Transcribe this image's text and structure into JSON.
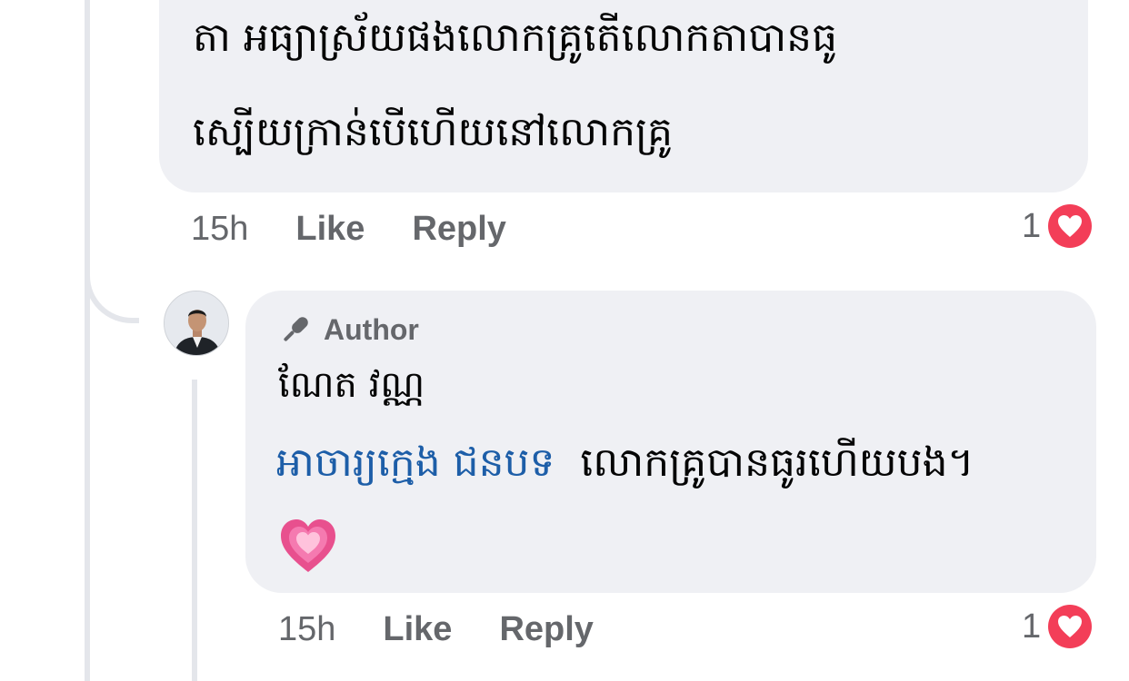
{
  "comment": {
    "lines": [
      "តា អធ្យាស្រ័យផងលោកគ្រូតើលោកតាបានធូ",
      "ស្បើយក្រាន់បើហើយនៅលោកគ្រូ"
    ],
    "time": "15h",
    "like_label": "Like",
    "reply_label": "Reply",
    "reaction_count": "1",
    "reaction_icon": "heart-icon"
  },
  "reply": {
    "badge_label": "Author",
    "badge_icon": "microphone-icon",
    "author_name": "ណែត វណ្ណ",
    "mention": "អាចារ្យក្មេង ជនបទ",
    "text": "លោកគ្រូបានធូរហើយបង។",
    "emoji": "growing-heart-emoji",
    "time": "15h",
    "like_label": "Like",
    "reply_label": "Reply",
    "reaction_count": "1",
    "reaction_icon": "heart-icon"
  },
  "colors": {
    "bubble": "#eff0f4",
    "thread_line": "#e4e6eb",
    "meta_text": "#65676b",
    "mention": "#1d5ea8",
    "love_reaction": "#f33e58"
  }
}
